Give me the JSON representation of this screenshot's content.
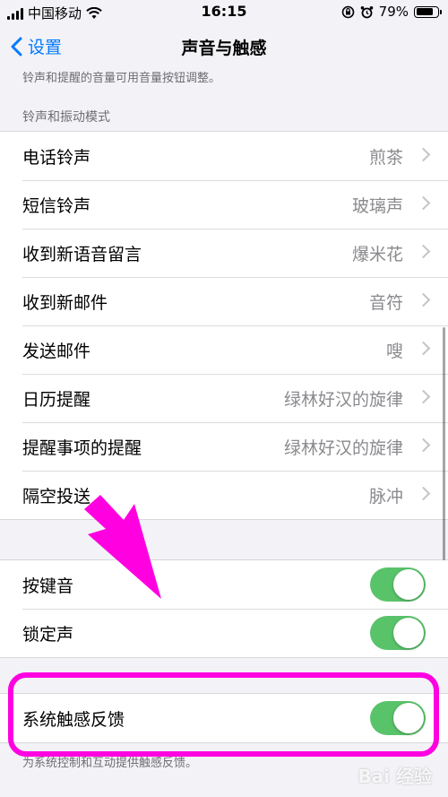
{
  "status_bar": {
    "carrier": "中国移动",
    "time": "16:15",
    "battery": "79%",
    "battery_level": 0.79
  },
  "nav": {
    "back_label": "设置",
    "title": "声音与触感"
  },
  "top_footer": "铃声和提醒的音量可用音量按钮调整。",
  "ringtone_section": {
    "header": "铃声和振动模式",
    "rows": [
      {
        "label": "电话铃声",
        "value": "煎茶"
      },
      {
        "label": "短信铃声",
        "value": "玻璃声"
      },
      {
        "label": "收到新语音留言",
        "value": "爆米花"
      },
      {
        "label": "收到新邮件",
        "value": "音符"
      },
      {
        "label": "发送邮件",
        "value": "嗖"
      },
      {
        "label": "日历提醒",
        "value": "绿林好汉的旋律"
      },
      {
        "label": "提醒事项的提醒",
        "value": "绿林好汉的旋律"
      },
      {
        "label": "隔空投送",
        "value": "脉冲"
      }
    ]
  },
  "toggle_section": {
    "rows": [
      {
        "label": "按键音",
        "on": true
      },
      {
        "label": "锁定声",
        "on": true
      }
    ]
  },
  "haptic_section": {
    "label": "系统触感反馈",
    "on": true,
    "footer": "为系统控制和互动提供触感反馈。"
  },
  "colors": {
    "accent": "#007aff",
    "toggle_on": "#59c36a",
    "annotation": "#ff00e0"
  },
  "watermark": "Bai 经验"
}
